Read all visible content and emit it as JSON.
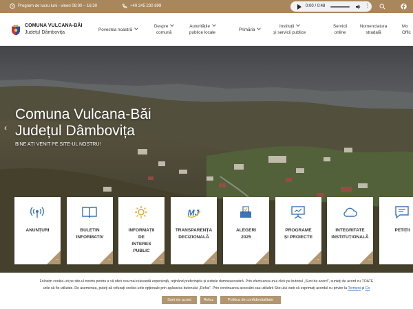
{
  "topbar": {
    "schedule": "Program de lucru luni - vineri 08:00 – 16:30",
    "phone": "+40 245 230 899",
    "audio_time": "0:00 / 0:48",
    "icons": [
      "clock-icon",
      "phone-icon",
      "play-icon",
      "volume-icon",
      "search-icon",
      "facebook-icon"
    ]
  },
  "header": {
    "logo_line1": "COMUNA VULCANA-BĂI",
    "logo_line2": "Județul Dâmbovița",
    "nav": [
      {
        "l1": "Povestea noastră",
        "l2": ""
      },
      {
        "l1": "Despre",
        "l2": "comună"
      },
      {
        "l1": "Autoritățile",
        "l2": "publice locale"
      },
      {
        "l1": "Primăria",
        "l2": ""
      },
      {
        "l1": "Instituții",
        "l2": "și servicii publice"
      },
      {
        "l1": "Servicii",
        "l2": "online"
      },
      {
        "l1": "Nomenclatura",
        "l2": "stradală"
      },
      {
        "l1": "Mo",
        "l2": "Offic"
      }
    ]
  },
  "hero": {
    "title_line1": "Comuna Vulcana-Băi",
    "title_line2": "Județul Dâmbovița",
    "subtitle": "BINE AȚI VENIT PE SITE-UL NOSTRU!"
  },
  "cards": [
    {
      "l1": "ANUNȚURI",
      "l2": "",
      "l3": "",
      "l4": ""
    },
    {
      "l1": "BULETIN",
      "l2": "INFORMATIV",
      "l3": "",
      "l4": ""
    },
    {
      "l1": "INFORMAȚII",
      "l2": "DE",
      "l3": "INTERES",
      "l4": "PUBLIC"
    },
    {
      "l1": "TRANSPARENȚA",
      "l2": "DECIZIONALĂ",
      "l3": "",
      "l4": ""
    },
    {
      "l1": "ALEGERI",
      "l2": "2025",
      "l3": "",
      "l4": ""
    },
    {
      "l1": "PROGRAME",
      "l2": "ȘI PROIECTE",
      "l3": "",
      "l4": ""
    },
    {
      "l1": "INTEGRITATE",
      "l2": "INSTITUȚIONALĂ",
      "l3": "",
      "l4": ""
    },
    {
      "l1": "PETIȚII",
      "l2": "",
      "l3": "",
      "l4": ""
    }
  ],
  "cookie": {
    "line1": "Folosim cookie-uri pe site-ul nostru pentru a vă oferi cea mai relevantă experiență, reținând preferințele și vizitele dumneavoastră. Prin efectuarea unui click pe butonul „Sunt de acord”, sunteți de acord cu TOATE",
    "line2a": "urile să fie utilizate. De asemenea, puteți să refuzați cookie-urile opționale prin apăsarea butonului „Refuz”. Prin continuarea accesării sau utilizării Site-ului web vă exprimați acordul cu privire la",
    "link1": "Termeni",
    "link2": "Co",
    "accept_label": "Sunt de acord",
    "refuse_label": "Refuz",
    "policy_label": "Politica de confidențialitate"
  },
  "colors": {
    "accent": "#a8875c",
    "card_corner": "#b19670"
  }
}
